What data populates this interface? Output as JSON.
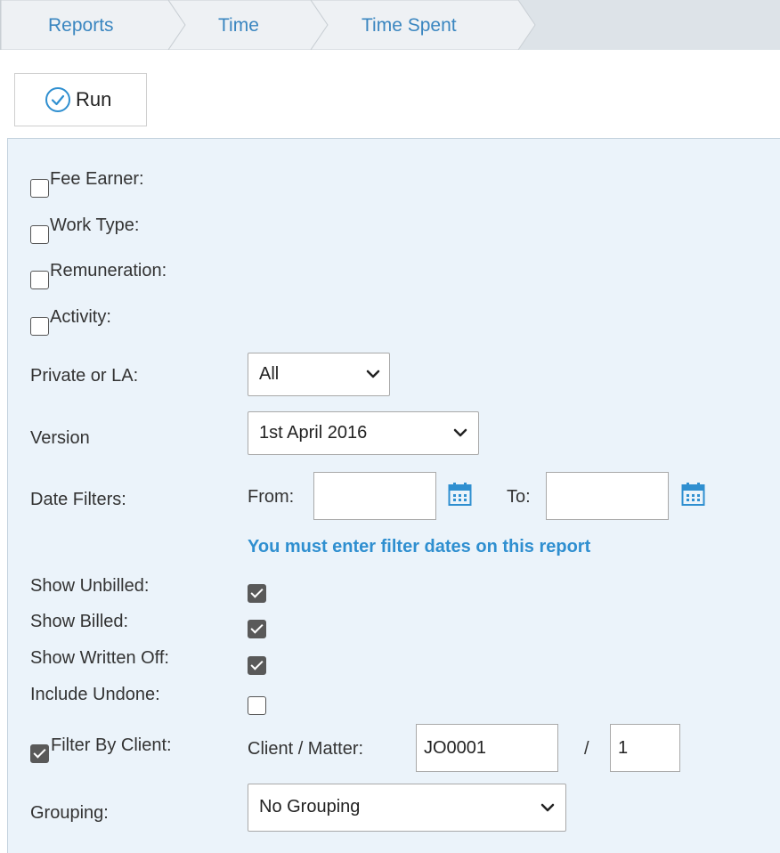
{
  "breadcrumb": {
    "items": [
      {
        "label": "Reports"
      },
      {
        "label": "Time"
      },
      {
        "label": "Time Spent"
      }
    ]
  },
  "toolbar": {
    "run_label": "Run",
    "run_icon": "check-circle-icon"
  },
  "filters": {
    "fee_earner": {
      "label": "Fee Earner:",
      "checked": false
    },
    "work_type": {
      "label": "Work Type:",
      "checked": false
    },
    "remuneration": {
      "label": "Remuneration:",
      "checked": false
    },
    "activity": {
      "label": "Activity:",
      "checked": false
    },
    "private_or_la": {
      "label": "Private or LA:",
      "value": "All"
    },
    "version": {
      "label": "Version",
      "value": "1st April 2016"
    },
    "date_filters": {
      "label": "Date Filters:",
      "from_label": "From:",
      "from_value": "",
      "to_label": "To:",
      "to_value": "",
      "warning": "You must enter filter dates on this report"
    },
    "show_unbilled": {
      "label": "Show Unbilled:",
      "checked": true
    },
    "show_billed": {
      "label": "Show Billed:",
      "checked": true
    },
    "show_written_off": {
      "label": "Show Written Off:",
      "checked": true
    },
    "include_undone": {
      "label": "Include Undone:",
      "checked": false
    },
    "filter_by_client": {
      "label": "Filter By Client:",
      "checked": true,
      "client_matter_label": "Client / Matter:",
      "client_value": "JO0001",
      "separator": "/",
      "matter_value": "1"
    },
    "grouping": {
      "label": "Grouping:",
      "value": "No Grouping"
    }
  },
  "colors": {
    "link": "#3a86c0",
    "warning": "#2f8fd0",
    "panel_bg": "#ebf3fa",
    "breadcrumb_bg": "#dde3e8",
    "checkbox_checked": "#595959"
  }
}
